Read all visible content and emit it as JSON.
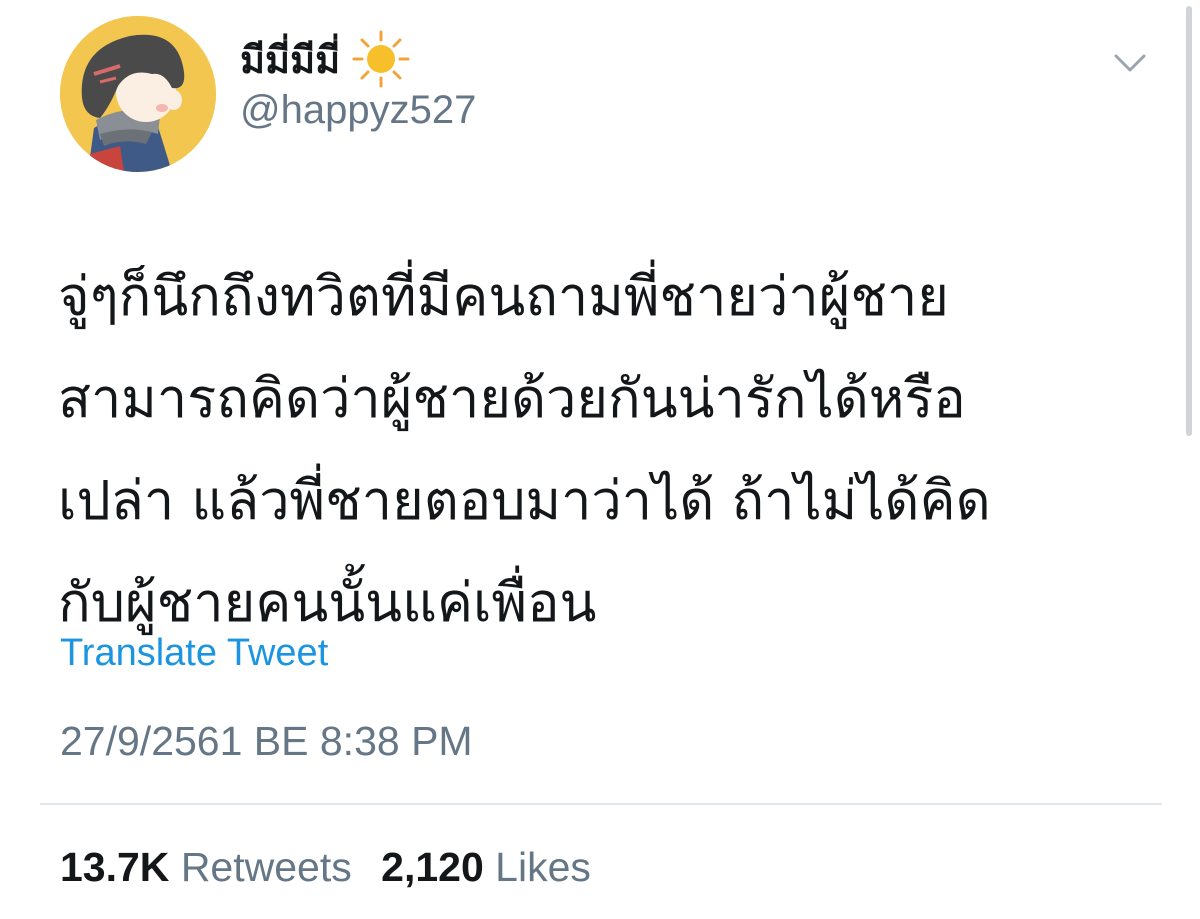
{
  "user": {
    "display_name": "มีมี่มีมี่",
    "handle": "@happyz527",
    "avatar_icon": "avatar-cartoon-boy",
    "badge_icon": "sun-icon"
  },
  "tweet": {
    "text_lines": [
      "จู่ๆก็นึกถึงทวิตที่มีคนถามพี่ชายว่าผู้ชาย",
      "สามารถคิดว่าผู้ชายด้วยกันน่ารักได้หรือ",
      "เปล่า แล้วพี่ชายตอบมาว่าได้ ถ้าไม่ได้คิด",
      "กับผู้ชายคนนั้นแค่เพื่อน"
    ],
    "translate_label": "Translate Tweet",
    "timestamp": "27/9/2561 BE 8:38 PM"
  },
  "stats": {
    "retweets_count": "13.7K",
    "retweets_label": "Retweets",
    "likes_count": "2,120",
    "likes_label": "Likes"
  },
  "colors": {
    "link": "#1b95e0",
    "secondary_text": "#657786",
    "divider": "#e1e8ed",
    "avatar_bg": "#f3c64f"
  }
}
